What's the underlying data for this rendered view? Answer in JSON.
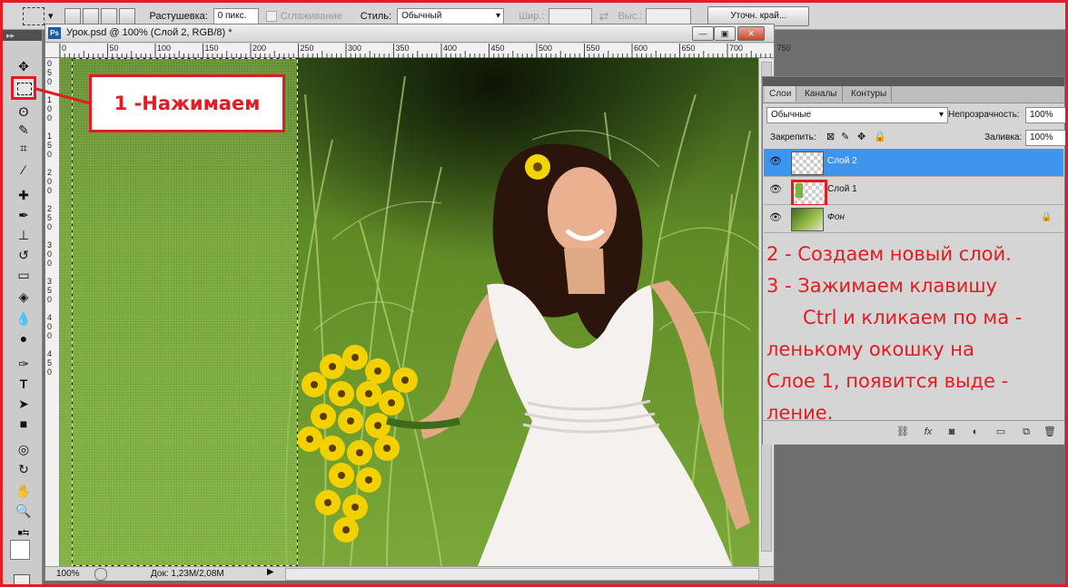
{
  "options_bar": {
    "feather_label": "Растушевка:",
    "feather_value": "0 пикс.",
    "antialias_label": "Сглаживание",
    "style_label": "Стиль:",
    "style_value": "Обычный",
    "width_label": "Шир.:",
    "height_label": "Выс.:",
    "refine_edge_button": "Уточн. край..."
  },
  "document": {
    "title": "Урок.psd @ 100% (Слой 2, RGB/8) *",
    "ps_badge": "Ps",
    "ruler_top": [
      "0",
      "50",
      "100",
      "150",
      "200",
      "250",
      "300",
      "350",
      "400",
      "450",
      "500",
      "550",
      "600",
      "650",
      "700",
      "750"
    ],
    "ruler_left": [
      "0",
      "5",
      "0",
      "1",
      "0",
      "0",
      "1",
      "5",
      "0",
      "2",
      "0",
      "0",
      "2",
      "5",
      "0",
      "3",
      "0",
      "0",
      "3",
      "5",
      "0",
      "4",
      "0",
      "0",
      "4",
      "5",
      "0"
    ],
    "zoom": "100%",
    "doc_info": "Док: 1,23M/2,08M"
  },
  "callout_1": "1 -Нажимаем",
  "layers_panel": {
    "tabs": [
      "Слои",
      "Каналы",
      "Контуры"
    ],
    "blend_mode": "Обычные",
    "opacity_label": "Непрозрачность:",
    "opacity_value": "100%",
    "lock_label": "Закрепить:",
    "fill_label": "Заливка:",
    "fill_value": "100%",
    "layers": [
      {
        "name": "Слой 2",
        "selected": true
      },
      {
        "name": "Слой 1",
        "selected": false
      },
      {
        "name": "Фон",
        "selected": false,
        "locked": true
      }
    ]
  },
  "annotation_2": [
    "2 - Создаем новый слой.",
    "3 - Зажимаем клавишу",
    "      Ctrl и кликаем по ма -",
    "ленькому окошку на",
    "Слое 1, появится выде -",
    "ление."
  ],
  "colors": {
    "annotation_red": "#e31b23",
    "selected_layer": "#3d95f0",
    "panel_bg": "#d5d5d5"
  }
}
